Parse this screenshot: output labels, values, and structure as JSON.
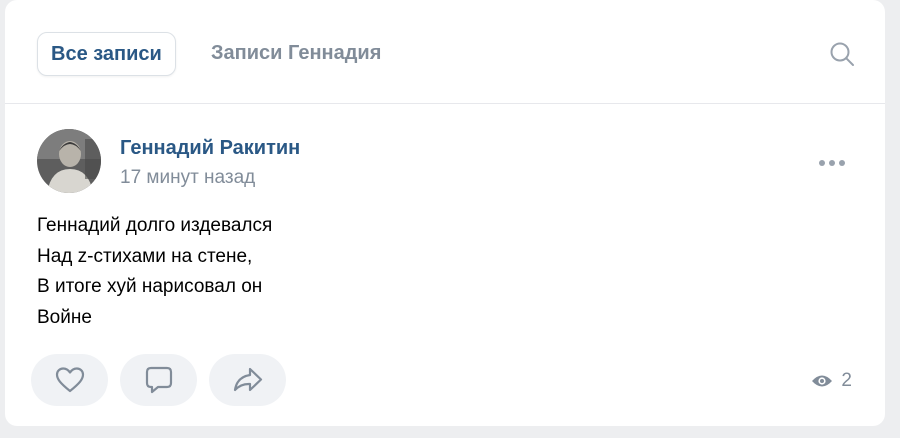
{
  "tabs": {
    "all_posts": "Все записи",
    "user_posts": "Записи Геннадия"
  },
  "post": {
    "author": "Геннадий Ракитин",
    "time": "17 минут назад",
    "text": "Геннадий долго издевался\nНад z-стихами на стене,\nВ итоге хуй нарисовал он\nВойне",
    "views": "2"
  },
  "icons": {
    "search": "search-icon",
    "more": "more-horizontal-icon",
    "like": "heart-icon",
    "comment": "comment-icon",
    "share": "share-icon",
    "views": "eye-icon"
  },
  "colors": {
    "link": "#2a5885",
    "secondary": "#818c99",
    "icon": "#99a2ad",
    "action_bg": "#f0f2f5"
  }
}
